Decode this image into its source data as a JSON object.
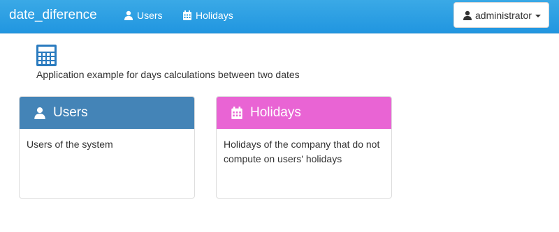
{
  "app": {
    "brand": "date_diference"
  },
  "nav": {
    "items": [
      {
        "label": "Users",
        "icon": "user-icon"
      },
      {
        "label": "Holidays",
        "icon": "calendar-icon"
      }
    ],
    "user_menu": {
      "label": "administrator",
      "icon": "user-icon"
    }
  },
  "hero": {
    "icon": "calculator-icon",
    "description": "Application example for days calculations between two dates"
  },
  "cards": [
    {
      "title": "Users",
      "icon": "user-icon",
      "body": "Users of the system",
      "color": "#4484b7"
    },
    {
      "title": "Holidays",
      "icon": "calendar-icon",
      "body": "Holidays of the company that do not compute on users' holidays",
      "color": "#e964d4"
    }
  ],
  "colors": {
    "navbar": "#2196e0",
    "text": "#333333"
  }
}
